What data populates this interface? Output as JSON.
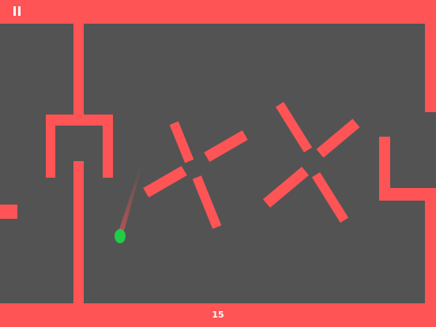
{
  "hud": {
    "score": "15",
    "pause_icon": "pause-icon"
  },
  "colors": {
    "background": "#535353",
    "wall": "#fe5456",
    "ball": "#22cc44",
    "text": "#ffffff"
  }
}
